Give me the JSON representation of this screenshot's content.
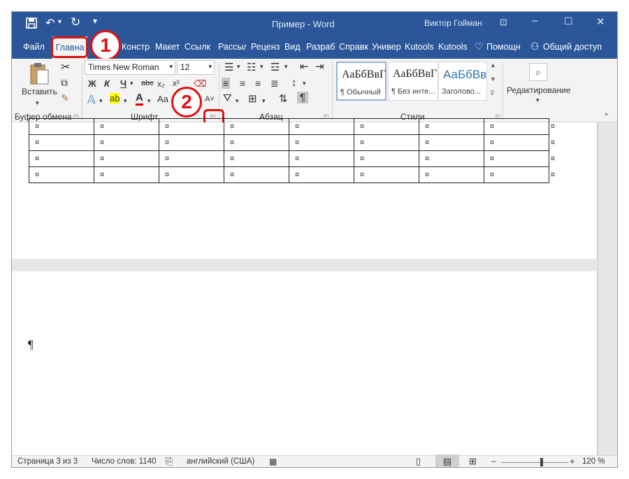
{
  "titlebar": {
    "doc_title": "Пример  -  Word",
    "user": "Виктор Гойман",
    "save_icon": "save-icon",
    "undo_icon": "undo-icon",
    "redo_icon": "redo-icon"
  },
  "tabs": [
    "Файл",
    "Главна",
    "Констр",
    "Макет",
    "Ссылк",
    "Рассыл",
    "Реценз",
    "Вид",
    "Разраб",
    "Справк",
    "Универ",
    "Kutools",
    "Kutools",
    "Помощн",
    "Общий доступ"
  ],
  "ribbon": {
    "paste_label": "Вставить",
    "font_name": "Times New Roman",
    "font_size": "12",
    "bold": "Ж",
    "italic": "К",
    "underline": "Ч",
    "strike": "abc",
    "sub": "x₂",
    "sup": "x²",
    "font_color_letter": "A",
    "case_label": "Aa",
    "groups": [
      "Буфер обмена",
      "Шрифт",
      "Абзац",
      "Стили",
      "Редактирование"
    ],
    "styles": [
      {
        "sample": "АаБбВвГ",
        "name": "¶ Обычный"
      },
      {
        "sample": "АаБбВвГ",
        "name": "¶ Без инте..."
      },
      {
        "sample": "АаБбВв",
        "name": "Заголово..."
      }
    ],
    "pilcrow": "¶"
  },
  "callouts": [
    "1",
    "2"
  ],
  "document": {
    "cell_mark": "¤",
    "rows": 4,
    "cols": 8,
    "paragraph_mark": "¶"
  },
  "status": {
    "page": "Страница 3 из 3",
    "words": "Число слов: 1140",
    "language": "английский (США)",
    "zoom": "120 %",
    "zoom_level": 0.6
  }
}
